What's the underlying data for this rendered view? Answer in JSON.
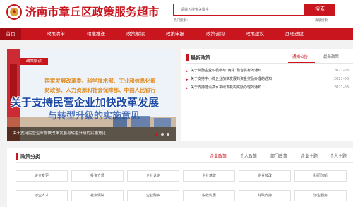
{
  "header": {
    "title": "济南市章丘区政策服务超市",
    "search": {
      "placeholder": "请输入搜索关键字",
      "button_label": "搜索"
    },
    "hot_search_label": "热门搜索：",
    "advanced_search_label": "高级搜索"
  },
  "nav": {
    "items": [
      "首页",
      "政策清单",
      "精准推送",
      "政策解读",
      "政策申报",
      "政策咨询",
      "政策建议",
      "办理进度"
    ],
    "active": "首页"
  },
  "carousel": {
    "tag": "政策解读",
    "orgs_line1": "国家发展改革委、科学技术部、工业和信息化部",
    "orgs_line2": "财政部、人力资源和社会保障部、中国人民银行",
    "headline": "关于支持民营企业加快改革发展",
    "headline2": "与转型升级的实施意见",
    "caption": "关于支持民营企业加快改革发展与转型升级的实施意见"
  },
  "latest_policy": {
    "title": "最新政策",
    "tabs": [
      "通知公告",
      "最新政策"
    ],
    "active_tab": "通知公告",
    "items": [
      {
        "text": "关于奖励企业积极参与“两化”融合贯标的通知",
        "date": "2021-08-"
      },
      {
        "text": "关于支持中小微企业加快发展的资金奖励办理的通知",
        "date": "2021-08-"
      },
      {
        "text": "关于支持建设高水平研发机构奖励办理的通知",
        "date": "2021-08-"
      }
    ]
  },
  "category": {
    "title": "政策分类",
    "tabs": [
      "企业政策",
      "个人政策",
      "部门政策",
      "企业主题",
      "个人主题"
    ],
    "active_tab": "企业政策",
    "row1": [
      "设立变更",
      "投资立项",
      "企业认定",
      "企业基建",
      "企业技改",
      "科研创新"
    ],
    "row2": [
      "涉企人才",
      "社会保障",
      "企业融资",
      "税收优惠",
      "财政支持",
      "涉企服务"
    ]
  },
  "colors": {
    "brand_red": "#c9151e",
    "headline_blue": "#1c4aa4",
    "orgs_orange": "#e08a1e"
  }
}
